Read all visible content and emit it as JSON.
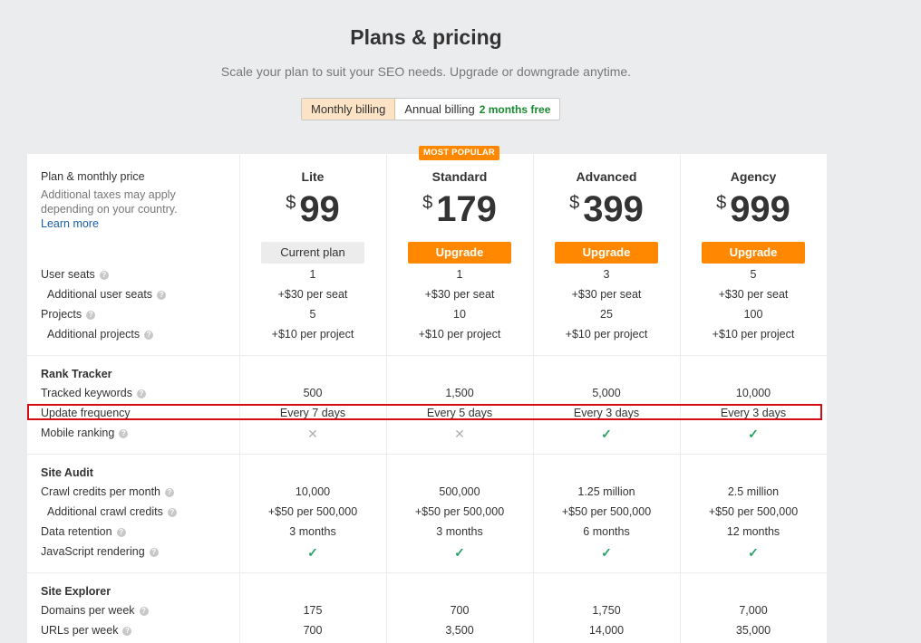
{
  "header": {
    "title": "Plans & pricing",
    "subtitle": "Scale your plan to suit your SEO needs. Upgrade or downgrade anytime."
  },
  "billing_toggle": {
    "monthly_label": "Monthly billing",
    "annual_label": "Annual billing",
    "annual_promo": "2 months free",
    "selected": "Monthly billing"
  },
  "badge": {
    "label": "MOST POPULAR"
  },
  "plan_header": {
    "label": "Plan & monthly price",
    "note_line1": "Additional taxes may apply",
    "note_line2": "depending on your country.",
    "learn_more": "Learn more"
  },
  "plans": [
    {
      "name": "Lite",
      "currency": "$",
      "price": "99",
      "button": "Current plan"
    },
    {
      "name": "Standard",
      "currency": "$",
      "price": "179",
      "button": "Upgrade"
    },
    {
      "name": "Advanced",
      "currency": "$",
      "price": "399",
      "button": "Upgrade"
    },
    {
      "name": "Agency",
      "currency": "$",
      "price": "999",
      "button": "Upgrade"
    }
  ],
  "general_rows": [
    {
      "label": "User seats",
      "values": [
        "1",
        "1",
        "3",
        "5"
      ]
    },
    {
      "label": "Additional user seats",
      "values": [
        "+$30 per seat",
        "+$30 per seat",
        "+$30 per seat",
        "+$30 per seat"
      ]
    },
    {
      "label": "Projects",
      "values": [
        "5",
        "10",
        "25",
        "100"
      ]
    },
    {
      "label": "Additional projects",
      "values": [
        "+$10 per project",
        "+$10 per project",
        "+$10 per project",
        "+$10 per project"
      ]
    }
  ],
  "rank_tracker": {
    "title": "Rank Tracker",
    "rows": [
      {
        "label": "Tracked keywords",
        "values": [
          "500",
          "1,500",
          "5,000",
          "10,000"
        ]
      },
      {
        "label": "Update frequency",
        "values": [
          "Every 7 days",
          "Every 5 days",
          "Every 3 days",
          "Every 3 days"
        ]
      },
      {
        "label": "Mobile ranking",
        "values": [
          "✕",
          "✕",
          "✓",
          "✓"
        ]
      }
    ]
  },
  "site_audit": {
    "title": "Site Audit",
    "rows": [
      {
        "label": "Crawl credits per month",
        "values": [
          "10,000",
          "500,000",
          "1.25 million",
          "2.5 million"
        ]
      },
      {
        "label": "Additional crawl credits",
        "values": [
          "+$50 per 500,000",
          "+$50 per 500,000",
          "+$50 per 500,000",
          "+$50 per 500,000"
        ]
      },
      {
        "label": "Data retention",
        "values": [
          "3 months",
          "3 months",
          "6 months",
          "12 months"
        ]
      },
      {
        "label": "JavaScript rendering",
        "values": [
          "✓",
          "✓",
          "✓",
          "✓"
        ]
      }
    ]
  },
  "site_explorer": {
    "title": "Site Explorer",
    "rows": [
      {
        "label": "Domains per week",
        "values": [
          "175",
          "700",
          "1,750",
          "7,000"
        ]
      },
      {
        "label": "URLs per week",
        "values": [
          "700",
          "3,500",
          "14,000",
          "35,000"
        ]
      }
    ]
  },
  "help_icon_glyph": "?",
  "colors": {
    "accent_orange": "#ff8800",
    "check_green": "#27a465",
    "promo_green": "#178a2e",
    "highlight_red": "#d40d14",
    "link_blue": "#1a5ea8"
  }
}
